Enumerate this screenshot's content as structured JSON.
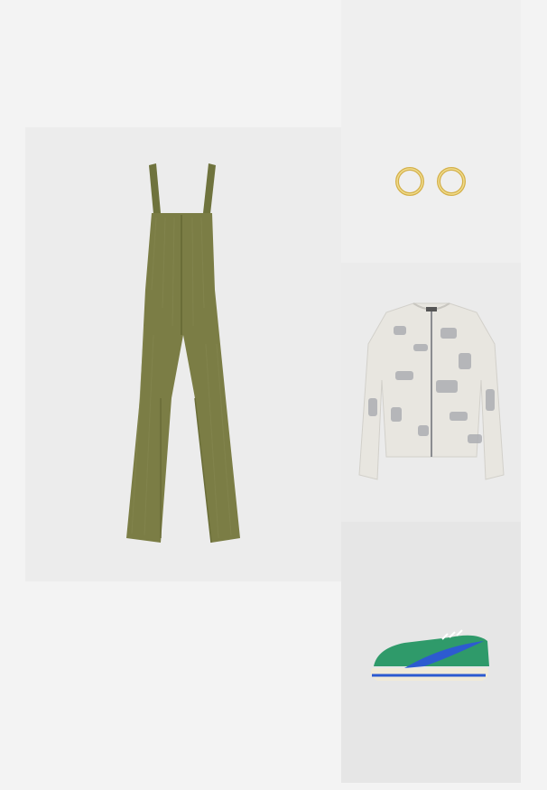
{
  "outfit": {
    "items": [
      {
        "id": "overalls",
        "icon": "corduroy-overalls-icon",
        "color": "#7b7d45"
      },
      {
        "id": "earrings",
        "icon": "gold-hoop-earrings-icon",
        "color": "#d4b04a"
      },
      {
        "id": "jacket",
        "icon": "fleece-jacket-icon",
        "color": "#e8e6e0"
      },
      {
        "id": "sneaker",
        "icon": "green-blue-sneaker-icon",
        "color": "#2f9a6a"
      }
    ]
  }
}
